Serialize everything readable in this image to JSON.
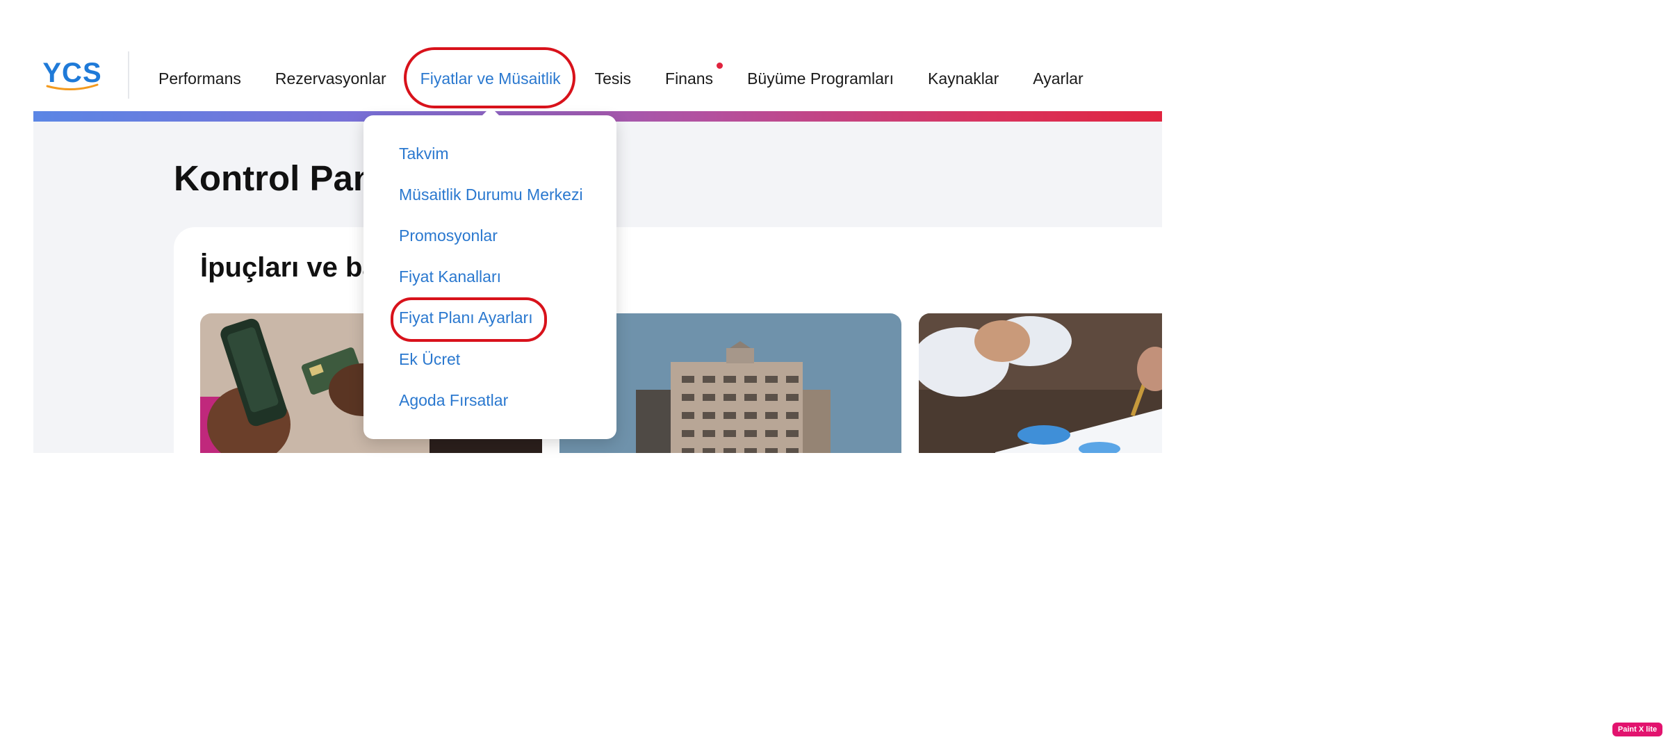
{
  "logo": {
    "text": "YCS"
  },
  "nav": {
    "items": [
      {
        "label": "Performans"
      },
      {
        "label": "Rezervasyonlar"
      },
      {
        "label": "Fiyatlar ve Müsaitlik",
        "active": true
      },
      {
        "label": "Tesis"
      },
      {
        "label": "Finans",
        "notification": true
      },
      {
        "label": "Büyüme Programları"
      },
      {
        "label": "Kaynaklar"
      },
      {
        "label": "Ayarlar"
      }
    ]
  },
  "dropdown": {
    "items": [
      {
        "label": "Takvim"
      },
      {
        "label": "Müsaitlik Durumu Merkezi"
      },
      {
        "label": "Promosyonlar"
      },
      {
        "label": "Fiyat Kanalları"
      },
      {
        "label": "Fiyat Planı Ayarları",
        "highlighted": true
      },
      {
        "label": "Ek Ücret"
      },
      {
        "label": "Agoda Fırsatlar"
      }
    ]
  },
  "page": {
    "title": "Kontrol Pan"
  },
  "tips": {
    "title": "İpuçları ve ba"
  },
  "badge": {
    "text": "Paint X lite"
  },
  "colors": {
    "brand": "#1f7ad8",
    "link": "#2a78cf",
    "annotation": "#d8121b",
    "notification": "#e0233e"
  }
}
